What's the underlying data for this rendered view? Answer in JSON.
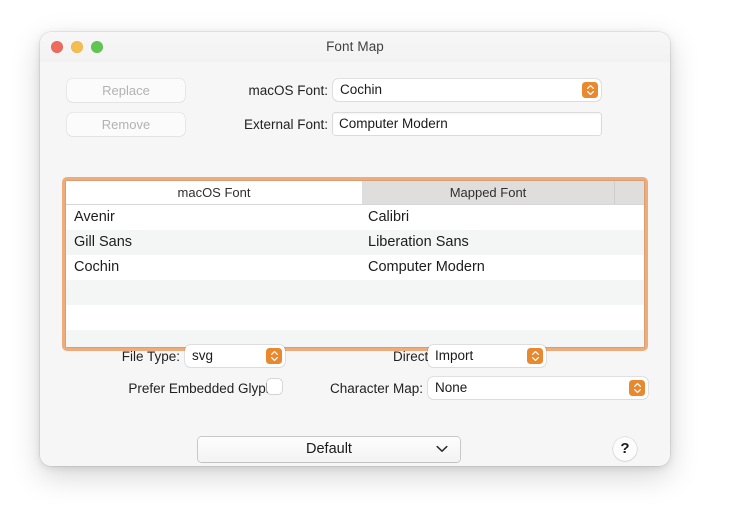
{
  "window": {
    "title": "Font Map",
    "traffic_lights": [
      {
        "name": "close",
        "color": "#ec6a5e"
      },
      {
        "name": "minimize",
        "color": "#f4bd4f"
      },
      {
        "name": "zoom",
        "color": "#61c554"
      }
    ]
  },
  "toolbar": {
    "replace_label": "Replace",
    "remove_label": "Remove"
  },
  "fields": {
    "macos_font_label": "macOS Font:",
    "macos_font_value": "Cochin",
    "external_font_label": "External Font:",
    "external_font_value": "Computer Modern"
  },
  "table": {
    "columns": [
      "macOS Font",
      "Mapped Font",
      ""
    ],
    "rows": [
      {
        "macos": "Avenir",
        "mapped": "Calibri"
      },
      {
        "macos": "Gill Sans",
        "mapped": "Liberation Sans"
      },
      {
        "macos": "Cochin",
        "mapped": "Computer Modern"
      },
      {
        "macos": "",
        "mapped": ""
      },
      {
        "macos": "",
        "mapped": ""
      },
      {
        "macos": "",
        "mapped": ""
      }
    ]
  },
  "options": {
    "file_type_label": "File Type:",
    "file_type_value": "svg",
    "direction_label": "Direction:",
    "direction_value": "Import",
    "prefer_embedded_label": "Prefer Embedded Glyphs",
    "character_map_label": "Character Map:",
    "character_map_value": "None"
  },
  "footer": {
    "preset_value": "Default",
    "help_label": "?"
  },
  "colors": {
    "accent": "#e8892f",
    "focus_ring": "#eeac7d",
    "window_bg": "#f6f6f6"
  }
}
